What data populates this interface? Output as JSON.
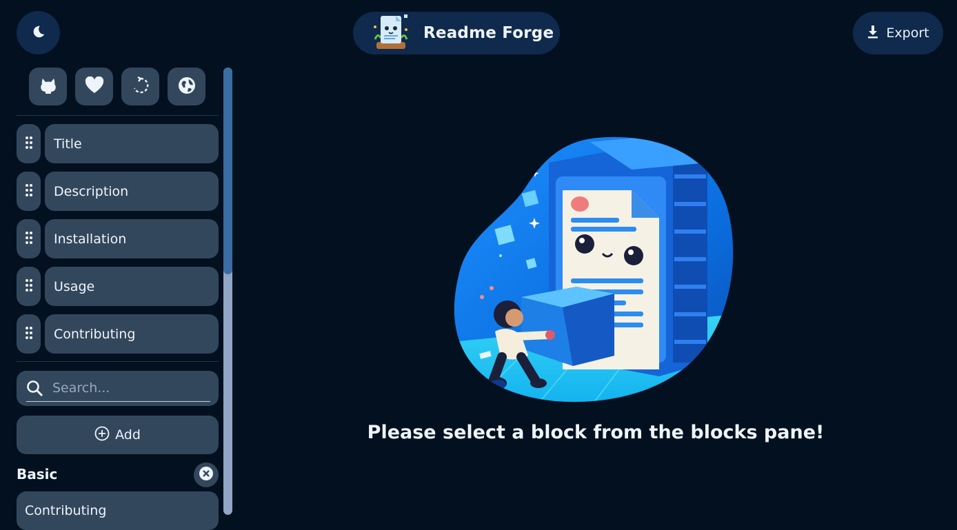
{
  "header": {
    "theme_toggle_icon": "moon-icon",
    "brand_title": "Readme Forge",
    "brand_logo_icon": "readme-mascot-icon",
    "export_label": "Export",
    "export_icon": "download-icon"
  },
  "sidebar": {
    "quick_links": [
      {
        "icon": "github-icon"
      },
      {
        "icon": "heart-icon"
      },
      {
        "icon": "reset-icon"
      },
      {
        "icon": "globe-icon"
      }
    ],
    "blocks": [
      {
        "label": "Title"
      },
      {
        "label": "Description"
      },
      {
        "label": "Installation"
      },
      {
        "label": "Usage"
      },
      {
        "label": "Contributing"
      }
    ],
    "search": {
      "placeholder": "Search...",
      "value": ""
    },
    "add_label": "Add",
    "group_title": "Basic",
    "templates": [
      {
        "label": "Contributing"
      }
    ]
  },
  "main": {
    "empty_message": "Please select a block from the blocks pane!"
  },
  "colors": {
    "background": "#03101f",
    "pill": "#0f2a4d",
    "block": "#33475c",
    "accent": "#1aa3ff"
  }
}
